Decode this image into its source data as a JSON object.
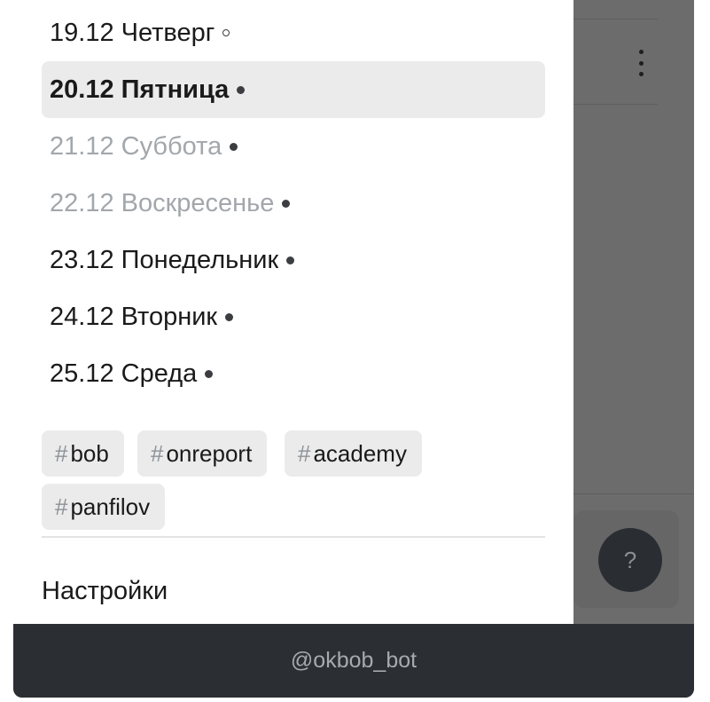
{
  "days": [
    {
      "label": "19.12 Четверг",
      "state": "normal",
      "dot": "hollow"
    },
    {
      "label": "20.12 Пятница",
      "state": "selected",
      "dot": "filled"
    },
    {
      "label": "21.12 Суббота",
      "state": "muted",
      "dot": "filled"
    },
    {
      "label": "22.12 Воскресенье",
      "state": "muted",
      "dot": "filled"
    },
    {
      "label": "23.12 Понедельник",
      "state": "normal",
      "dot": "filled"
    },
    {
      "label": "24.12 Вторник",
      "state": "normal",
      "dot": "filled"
    },
    {
      "label": "25.12 Среда",
      "state": "normal",
      "dot": "filled"
    }
  ],
  "tags": [
    {
      "hash": "#",
      "name": "bob"
    },
    {
      "hash": "#",
      "name": "onreport"
    },
    {
      "hash": "#",
      "name": "academy"
    },
    {
      "hash": "#",
      "name": "panfilov"
    }
  ],
  "menu": {
    "settings_label": "Настройки"
  },
  "footer": {
    "bot_handle": "@okbob_bot"
  },
  "background": {
    "help_button_label": "?",
    "kebab_icon": "more-vertical-icon"
  },
  "colors": {
    "selected_bg": "#ebebeb",
    "muted_text": "#a3a7ab",
    "footer_bg": "#2b2e32",
    "overlay": "#6c6c6c"
  }
}
